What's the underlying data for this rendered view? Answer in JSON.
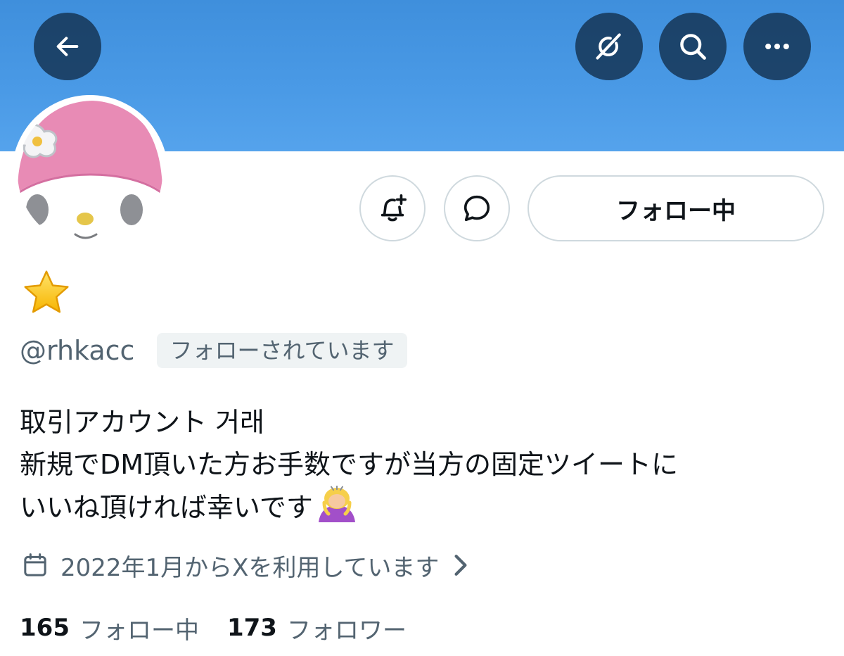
{
  "header": {
    "back_icon": "arrow-left-icon",
    "grok_icon": "grok-icon",
    "search_icon": "search-icon",
    "more_icon": "more-horizontal-icon",
    "banner_color": "#4a9ae6"
  },
  "profile": {
    "avatar_icon": "my-melody-avatar",
    "display_name_icon": "star-emoji",
    "handle": "@rhkacc",
    "follows_you_badge": "フォローされています",
    "bio_lines": [
      "取引アカウント 거래",
      "新規でDM頂いた方お手数ですが当方の固定ツイートに",
      "いいね頂ければ幸いです"
    ],
    "bio_end_emoji": "person-bowing-emoji",
    "joined": "2022年1月からXを利用しています",
    "joined_icon": "calendar-icon"
  },
  "actions": {
    "notify_icon": "bell-plus-icon",
    "message_icon": "message-bubble-icon",
    "follow_label": "フォロー中"
  },
  "stats": {
    "following_count": "165",
    "following_label": "フォロー中",
    "followers_count": "173",
    "followers_label": "フォロワー"
  }
}
